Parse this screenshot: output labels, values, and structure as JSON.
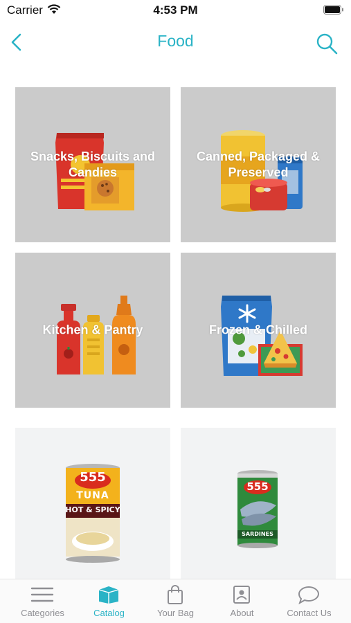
{
  "status_bar": {
    "carrier": "Carrier",
    "time": "4:53 PM"
  },
  "nav": {
    "title": "Food",
    "back_icon": "chevron-left-icon",
    "search_icon": "search-icon",
    "accent_color": "#2ab3c6"
  },
  "categories": [
    {
      "label": "Snacks, Biscuits and Candies",
      "icon": "snacks-illustration"
    },
    {
      "label": "Canned, Packaged & Preserved",
      "icon": "canned-goods-illustration"
    },
    {
      "label": "Kitchen & Pantry",
      "icon": "condiment-bottles-illustration"
    },
    {
      "label": "Frozen & Chilled",
      "icon": "frozen-food-illustration"
    }
  ],
  "products": [
    {
      "brand": "555",
      "name": "TUNA",
      "variant": "HOT & SPICY"
    },
    {
      "brand": "555",
      "name": "SARDINES"
    }
  ],
  "tabs": [
    {
      "label": "Categories",
      "icon": "list-icon",
      "active": false
    },
    {
      "label": "Catalog",
      "icon": "box-icon",
      "active": true
    },
    {
      "label": "Your Bag",
      "icon": "bag-icon",
      "active": false
    },
    {
      "label": "About",
      "icon": "contact-card-icon",
      "active": false
    },
    {
      "label": "Contact Us",
      "icon": "chat-bubble-icon",
      "active": false
    }
  ]
}
